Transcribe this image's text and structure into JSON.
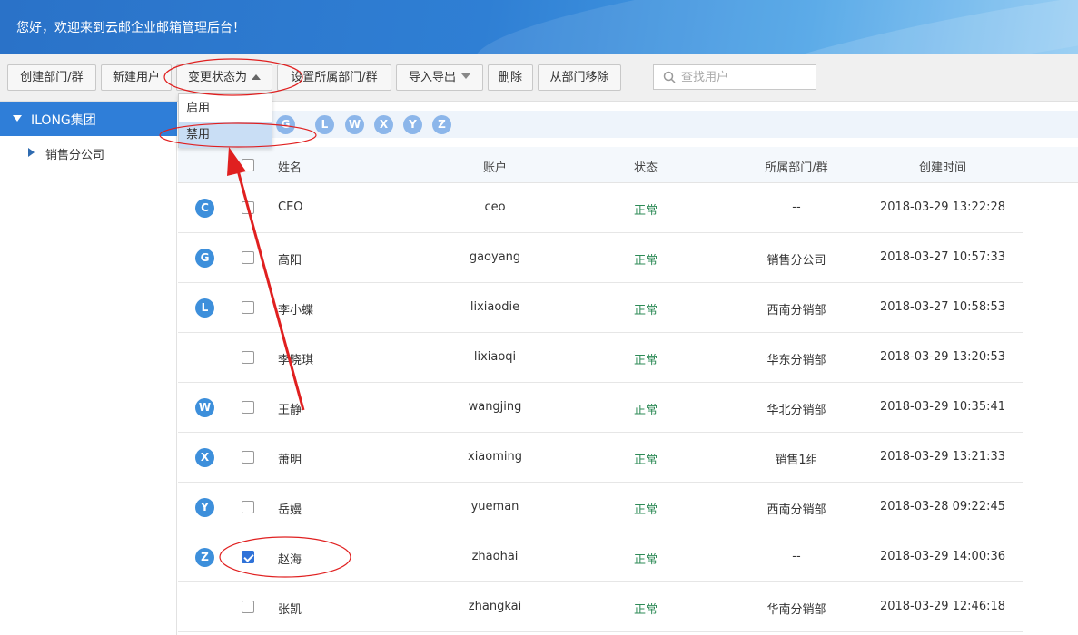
{
  "header": {
    "title": "您好，欢迎来到云邮企业邮箱管理后台！"
  },
  "toolbar": {
    "create_dept": "创建部门/群",
    "new_user": "新建用户",
    "change_status": "变更状态为",
    "set_dept": "设置所属部门/群",
    "import_export": "导入导出",
    "delete": "删除",
    "remove_from_dept": "从部门移除",
    "search_placeholder": "查找用户"
  },
  "dropdown": {
    "items": [
      "启用",
      "禁用"
    ],
    "highlighted": "禁用"
  },
  "sidebar": {
    "root": "ILONG集团",
    "children": [
      "销售分公司"
    ]
  },
  "letters": [
    "G",
    "L",
    "W",
    "X",
    "Y",
    "Z"
  ],
  "table": {
    "columns": [
      "姓名",
      "账户",
      "状态",
      "所属部门/群",
      "创建时间"
    ],
    "rows": [
      {
        "letter": "C",
        "checked": false,
        "name": "CEO",
        "account": "ceo",
        "status": "正常",
        "dept": "--",
        "time": "2018-03-29 13:22:28"
      },
      {
        "letter": "G",
        "checked": false,
        "name": "高阳",
        "account": "gaoyang",
        "status": "正常",
        "dept": "销售分公司",
        "time": "2018-03-27 10:57:33"
      },
      {
        "letter": "L",
        "checked": false,
        "name": "李小蝶",
        "account": "lixiaodie",
        "status": "正常",
        "dept": "西南分销部",
        "time": "2018-03-27 10:58:53"
      },
      {
        "letter": "",
        "checked": false,
        "name": "李晓琪",
        "account": "lixiaoqi",
        "status": "正常",
        "dept": "华东分销部",
        "time": "2018-03-29 13:20:53"
      },
      {
        "letter": "W",
        "checked": false,
        "name": "王静",
        "account": "wangjing",
        "status": "正常",
        "dept": "华北分销部",
        "time": "2018-03-29 10:35:41"
      },
      {
        "letter": "X",
        "checked": false,
        "name": "萧明",
        "account": "xiaoming",
        "status": "正常",
        "dept": "销售1组",
        "time": "2018-03-29 13:21:33"
      },
      {
        "letter": "Y",
        "checked": false,
        "name": "岳嫚",
        "account": "yueman",
        "status": "正常",
        "dept": "西南分销部",
        "time": "2018-03-28 09:22:45"
      },
      {
        "letter": "Z",
        "checked": true,
        "name": "赵海",
        "account": "zhaohai",
        "status": "正常",
        "dept": "--",
        "time": "2018-03-29 14:00:36"
      },
      {
        "letter": "",
        "checked": false,
        "name": "张凯",
        "account": "zhangkai",
        "status": "正常",
        "dept": "华南分销部",
        "time": "2018-03-29 12:46:18"
      }
    ]
  },
  "colors": {
    "accent": "#2f7ed8",
    "status_ok": "#2e8b57",
    "annotation": "#e02020"
  }
}
